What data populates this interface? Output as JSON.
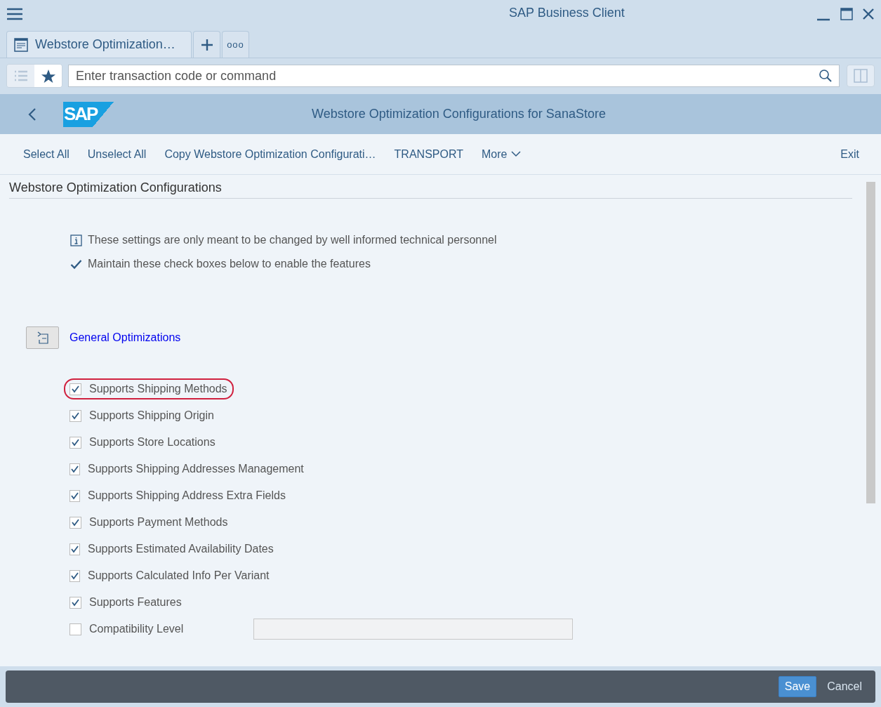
{
  "window": {
    "title": "SAP Business Client"
  },
  "tabs": [
    {
      "label": "Webstore Optimization…",
      "selected": true
    }
  ],
  "tab_more": "ooo",
  "command": {
    "placeholder": "Enter transaction code or command"
  },
  "header": {
    "logo": "SAP",
    "title": "Webstore Optimization Configurations for SanaStore"
  },
  "toolbar": {
    "actions": [
      "Select All",
      "Unselect All",
      "Copy Webstore Optimization Configurati…",
      "TRANSPORT"
    ],
    "more": "More",
    "exit": "Exit"
  },
  "section": {
    "title": "Webstore Optimization Configurations"
  },
  "notes": [
    {
      "kind": "info",
      "text": "These settings are only meant to be changed by well informed technical personnel"
    },
    {
      "kind": "check",
      "text": "Maintain these check boxes below to enable the features"
    }
  ],
  "group": {
    "title": "General Optimizations"
  },
  "options": [
    {
      "kind": "check",
      "label": "Supports Shipping Methods",
      "checked": true,
      "highlighted": true
    },
    {
      "kind": "check",
      "label": "Supports Shipping Origin",
      "checked": true,
      "highlighted": false
    },
    {
      "kind": "check",
      "label": "Supports Store Locations",
      "checked": true,
      "highlighted": false
    },
    {
      "kind": "check",
      "label": "Supports Shipping Addresses Management",
      "checked": true,
      "highlighted": false
    },
    {
      "kind": "check",
      "label": "Supports Shipping Address Extra Fields",
      "checked": true,
      "highlighted": false
    },
    {
      "kind": "check",
      "label": "Supports Payment Methods",
      "checked": true,
      "highlighted": false
    },
    {
      "kind": "check",
      "label": "Supports Estimated Availability Dates",
      "checked": true,
      "highlighted": false
    },
    {
      "kind": "check",
      "label": "Supports Calculated Info Per Variant",
      "checked": true,
      "highlighted": false
    },
    {
      "kind": "check",
      "label": "Supports Features",
      "checked": true,
      "highlighted": false
    },
    {
      "kind": "field",
      "label": "Compatibility Level",
      "checked": false,
      "highlighted": false,
      "disabled": true
    }
  ],
  "footer": {
    "buttons": [
      {
        "label": "Save",
        "primary": true
      },
      {
        "label": "Cancel",
        "primary": false
      }
    ]
  }
}
